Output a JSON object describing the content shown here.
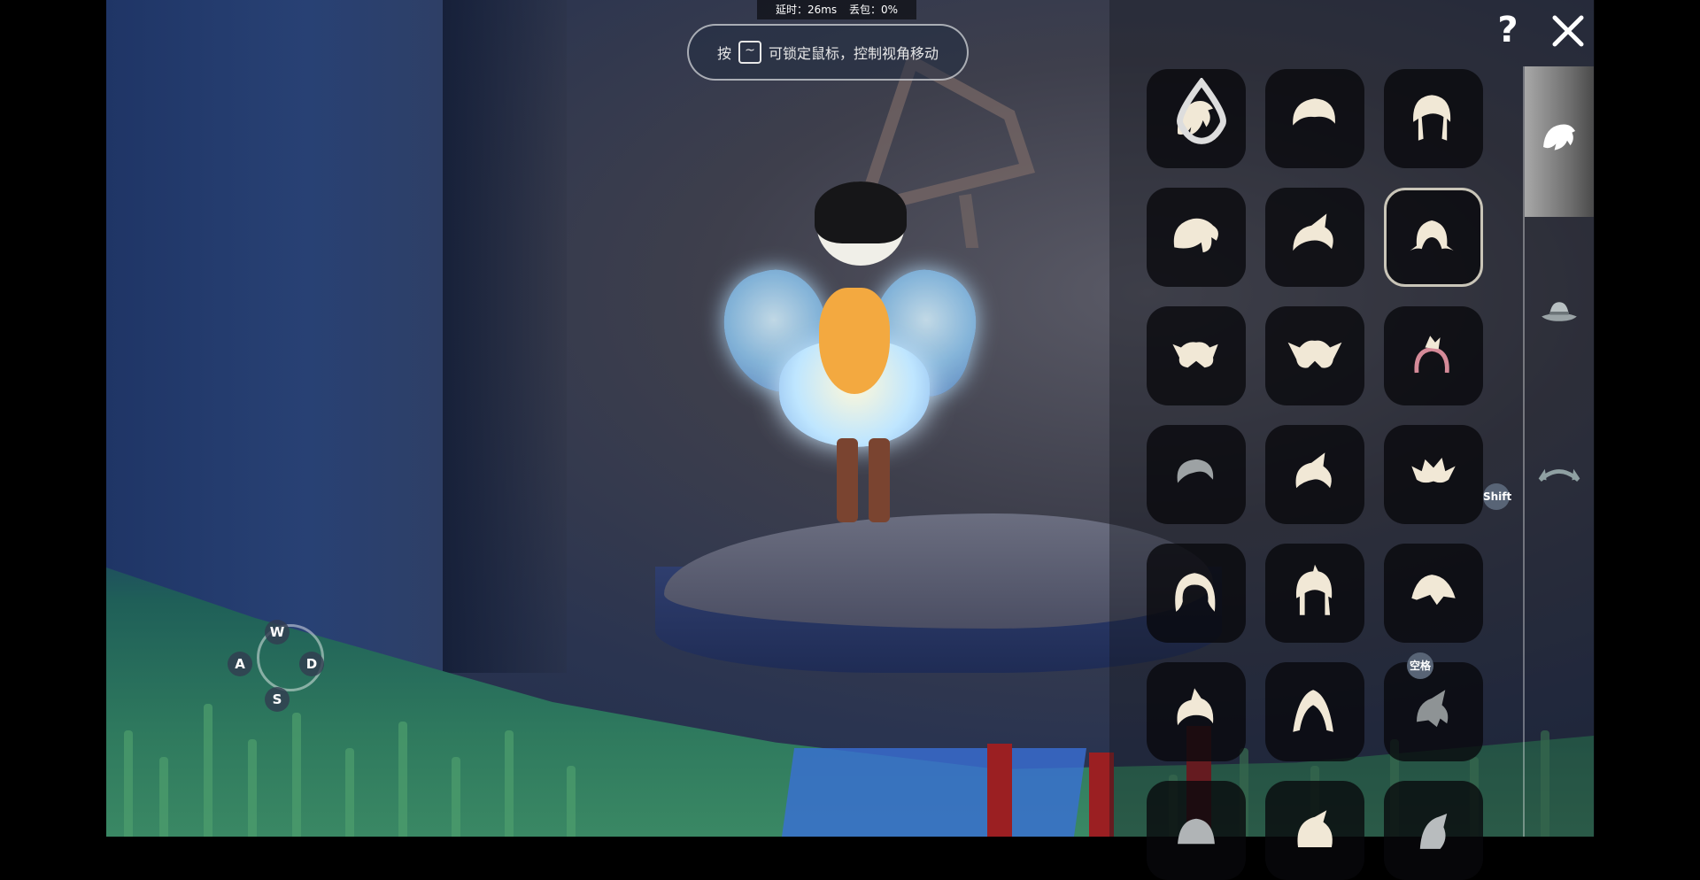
{
  "hud": {
    "latency_label": "延时：26ms",
    "packet_loss_label": "丢包：0%",
    "hint_prefix": "按",
    "hint_key": "~",
    "hint_text": "可锁定鼠标，控制视角移动"
  },
  "movement_keys": {
    "up": "W",
    "left": "A",
    "right": "D",
    "down": "S"
  },
  "wardrobe": {
    "help_label": "?",
    "shift_badge": "Shift",
    "space_badge": "空格",
    "selected_index": 5,
    "hair_items": [
      "hair-icon",
      "hair-icon",
      "hair-icon",
      "hair-icon",
      "hair-icon",
      "hair-icon",
      "hair-icon",
      "hair-icon",
      "hair-icon",
      "hair-icon",
      "hair-icon",
      "hair-icon",
      "hair-icon",
      "hair-icon",
      "hair-icon",
      "hair-icon",
      "hair-icon",
      "hair-icon",
      "hair-icon",
      "hair-icon",
      "hair-icon"
    ],
    "categories": [
      "hair-icon",
      "hat-icon",
      "hair-accessory-icon"
    ]
  },
  "colors": {
    "hair_icon": "#f1e8d6",
    "panel_cell": "#0b0b10",
    "selected_border": "#c9c5b8"
  }
}
